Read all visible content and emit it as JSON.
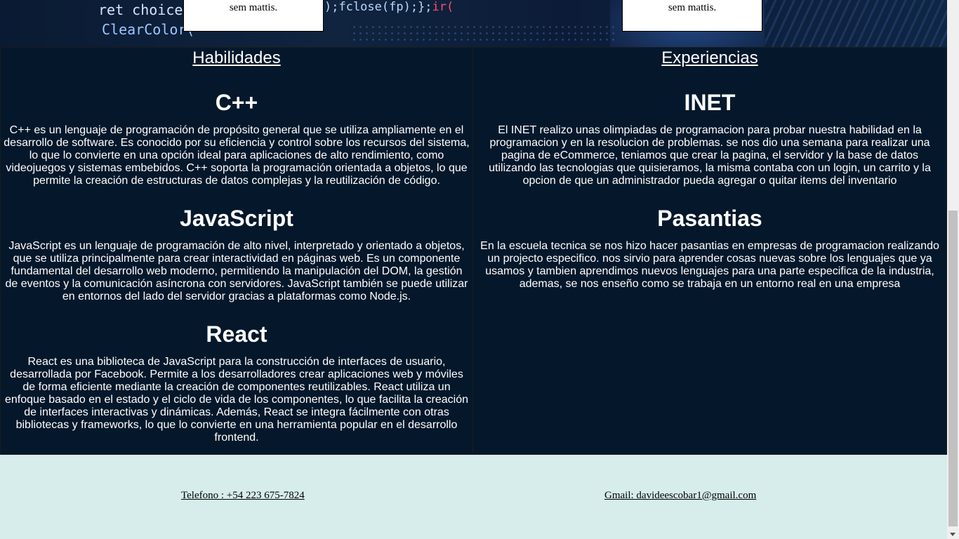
{
  "hero": {
    "code_line_1": "ret choice;c",
    "code_line_2": "ClearColor(",
    "code_line_3": ");fclose(fp);};",
    "code_line_3_tail": "ir(",
    "card_left": "sem mattis.",
    "card_right": "sem mattis."
  },
  "skills": {
    "title": "Habilidades",
    "items": [
      {
        "heading": "C++",
        "text": "C++ es un lenguaje de programación de propósito general que se utiliza ampliamente en el desarrollo de software. Es conocido por su eficiencia y control sobre los recursos del sistema, lo que lo convierte en una opción ideal para aplicaciones de alto rendimiento, como videojuegos y sistemas embebidos. C++ soporta la programación orientada a objetos, lo que permite la creación de estructuras de datos complejas y la reutilización de código."
      },
      {
        "heading": "JavaScript",
        "text": "JavaScript es un lenguaje de programación de alto nivel, interpretado y orientado a objetos, que se utiliza principalmente para crear interactividad en páginas web. Es un componente fundamental del desarrollo web moderno, permitiendo la manipulación del DOM, la gestión de eventos y la comunicación asíncrona con servidores. JavaScript también se puede utilizar en entornos del lado del servidor gracias a plataformas como Node.js."
      },
      {
        "heading": "React",
        "text": "React es una biblioteca de JavaScript para la construcción de interfaces de usuario, desarrollada por Facebook. Permite a los desarrolladores crear aplicaciones web y móviles de forma eficiente mediante la creación de componentes reutilizables. React utiliza un enfoque basado en el estado y el ciclo de vida de los componentes, lo que facilita la creación de interfaces interactivas y dinámicas. Además, React se integra fácilmente con otras bibliotecas y frameworks, lo que lo convierte en una herramienta popular en el desarrollo frontend."
      }
    ]
  },
  "experience": {
    "title": "Experiencias",
    "items": [
      {
        "heading": "INET",
        "text": "El INET realizo unas olimpiadas de programacion para probar nuestra habilidad en la programacion y en la resolucion de problemas. se nos dio una semana para realizar una pagina de eCommerce, teniamos que crear la pagina, el servidor y la base de datos utilizando las tecnologias que quisieramos, la misma contaba con un login, un carrito y la opcion de que un administrador pueda agregar o quitar items del inventario"
      },
      {
        "heading": "Pasantias",
        "text": "En la escuela tecnica se nos hizo hacer pasantias en empresas de programacion realizando un projecto especifico. nos sirvio para aprender cosas nuevas sobre los lenguajes que ya usamos y tambien aprendimos nuevos lenguajes para una parte especifica de la industria, ademas, se nos enseño como se trabaja en un entorno real en una empresa"
      }
    ]
  },
  "footer": {
    "phone": "Telefono : +54 223 675-7824",
    "email": "Gmail: davideescobar1@gmail.com"
  },
  "colors": {
    "content_bg": "#05182b",
    "footer_bg": "#d6edeb",
    "text_light": "#ffffff"
  }
}
